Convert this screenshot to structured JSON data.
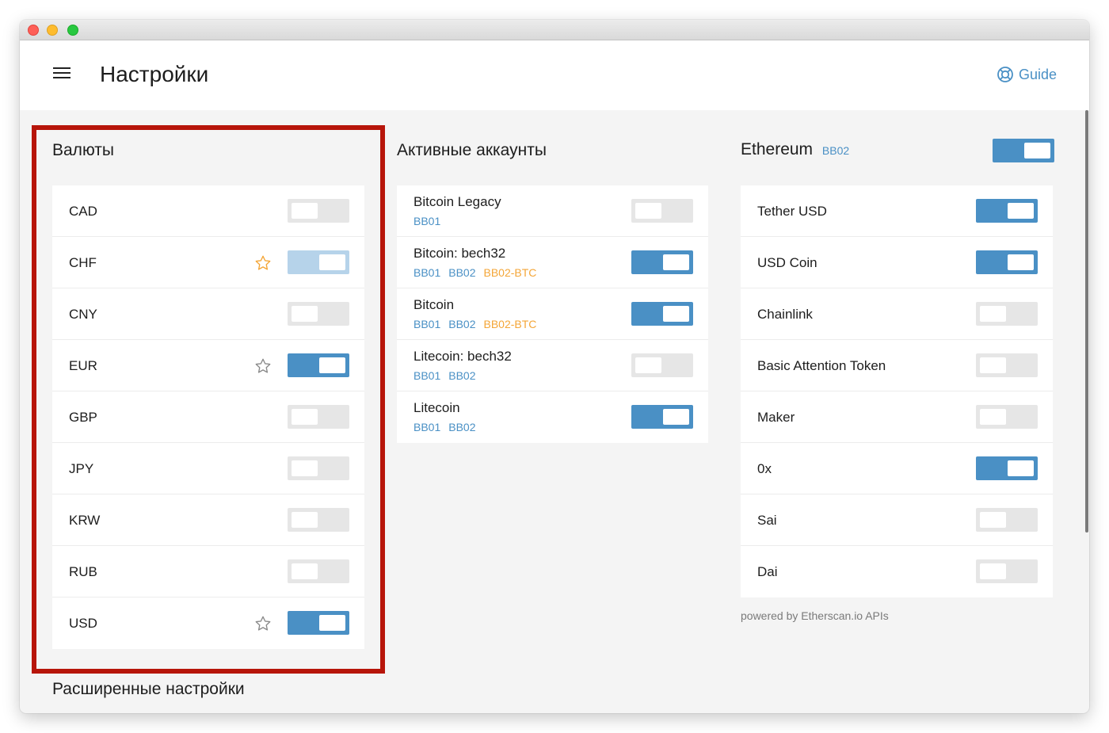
{
  "window": {
    "title": "Настройки",
    "guide_label": "Guide"
  },
  "currencies": {
    "title": "Валюты",
    "items": [
      {
        "code": "CAD",
        "enabled": false,
        "star": "none"
      },
      {
        "code": "CHF",
        "enabled": true,
        "star": "active",
        "toggle_state": "disabled"
      },
      {
        "code": "CNY",
        "enabled": false,
        "star": "none"
      },
      {
        "code": "EUR",
        "enabled": true,
        "star": "outline"
      },
      {
        "code": "GBP",
        "enabled": false,
        "star": "none"
      },
      {
        "code": "JPY",
        "enabled": false,
        "star": "none"
      },
      {
        "code": "KRW",
        "enabled": false,
        "star": "none"
      },
      {
        "code": "RUB",
        "enabled": false,
        "star": "none"
      },
      {
        "code": "USD",
        "enabled": true,
        "star": "outline"
      }
    ]
  },
  "accounts": {
    "title": "Активные аккаунты",
    "items": [
      {
        "name": "Bitcoin Legacy",
        "tags": [
          "BB01"
        ],
        "orange_tags": [],
        "enabled": false
      },
      {
        "name": "Bitcoin: bech32",
        "tags": [
          "BB01",
          "BB02"
        ],
        "orange_tags": [
          "BB02-BTC"
        ],
        "enabled": true
      },
      {
        "name": "Bitcoin",
        "tags": [
          "BB01",
          "BB02"
        ],
        "orange_tags": [
          "BB02-BTC"
        ],
        "enabled": true
      },
      {
        "name": "Litecoin: bech32",
        "tags": [
          "BB01",
          "BB02"
        ],
        "orange_tags": [],
        "enabled": false
      },
      {
        "name": "Litecoin",
        "tags": [
          "BB01",
          "BB02"
        ],
        "orange_tags": [],
        "enabled": true
      }
    ]
  },
  "ethereum": {
    "title": "Ethereum",
    "tag": "BB02",
    "enabled": true,
    "tokens": [
      {
        "name": "Tether USD",
        "enabled": true
      },
      {
        "name": "USD Coin",
        "enabled": true
      },
      {
        "name": "Chainlink",
        "enabled": false
      },
      {
        "name": "Basic Attention Token",
        "enabled": false
      },
      {
        "name": "Maker",
        "enabled": false
      },
      {
        "name": "0x",
        "enabled": true
      },
      {
        "name": "Sai",
        "enabled": false
      },
      {
        "name": "Dai",
        "enabled": false
      }
    ],
    "powered_by": "powered by Etherscan.io APIs"
  },
  "advanced": {
    "title": "Расширенные настройки"
  },
  "colors": {
    "accent": "#4a90c5",
    "orange": "#f4a638",
    "highlight": "#b7150a",
    "toggle_off": "#e6e6e6",
    "toggle_disabled": "#b6d3ea"
  },
  "icons": {
    "menu": "hamburger-icon",
    "guide": "lifebuoy-icon",
    "favorite": "star-icon"
  }
}
